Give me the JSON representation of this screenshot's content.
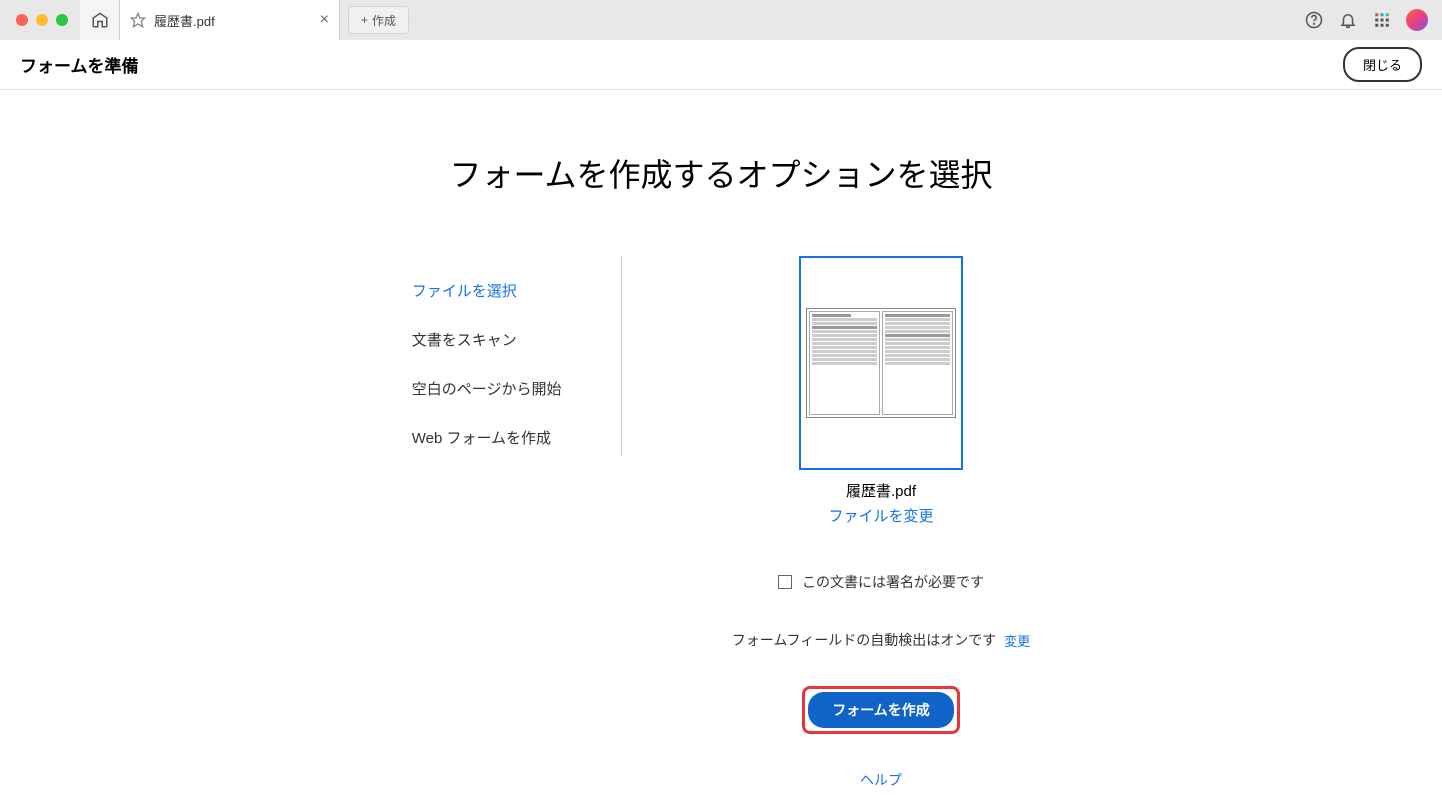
{
  "titlebar": {
    "file_tab_label": "履歴書.pdf",
    "new_tab_label": "作成"
  },
  "header": {
    "title": "フォームを準備",
    "close_label": "閉じる"
  },
  "main": {
    "title": "フォームを作成するオプションを選択",
    "options": {
      "select_file": "ファイルを選択",
      "scan_document": "文書をスキャン",
      "start_blank": "空白のページから開始",
      "web_form": "Web フォームを作成"
    },
    "preview": {
      "filename": "履歴書.pdf",
      "change_file_label": "ファイルを変更"
    },
    "signature": {
      "label": "この文書には署名が必要です"
    },
    "autodetect": {
      "label": "フォームフィールドの自動検出はオンです",
      "change_label": "変更"
    },
    "create_button_label": "フォームを作成",
    "help_label": "ヘルプ"
  }
}
